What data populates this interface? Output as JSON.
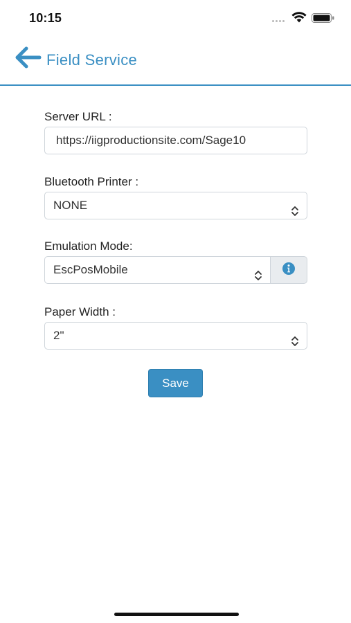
{
  "status_bar": {
    "time": "10:15",
    "icons": [
      "signal-dots-icon",
      "wifi-icon",
      "battery-icon"
    ]
  },
  "header": {
    "back_icon": "arrow-left-icon",
    "title": "Field Service",
    "accent_color": "#3a8fc3"
  },
  "form": {
    "server_url": {
      "label": "Server URL :",
      "value": "https://iigproductionsite.com/Sage10"
    },
    "bluetooth_printer": {
      "label": "Bluetooth Printer :",
      "selected": "NONE"
    },
    "emulation_mode": {
      "label": "Emulation Mode:",
      "selected": "EscPosMobile",
      "info_icon": "info-circle-icon"
    },
    "paper_width": {
      "label": "Paper Width :",
      "selected": "2\""
    },
    "save_label": "Save"
  }
}
